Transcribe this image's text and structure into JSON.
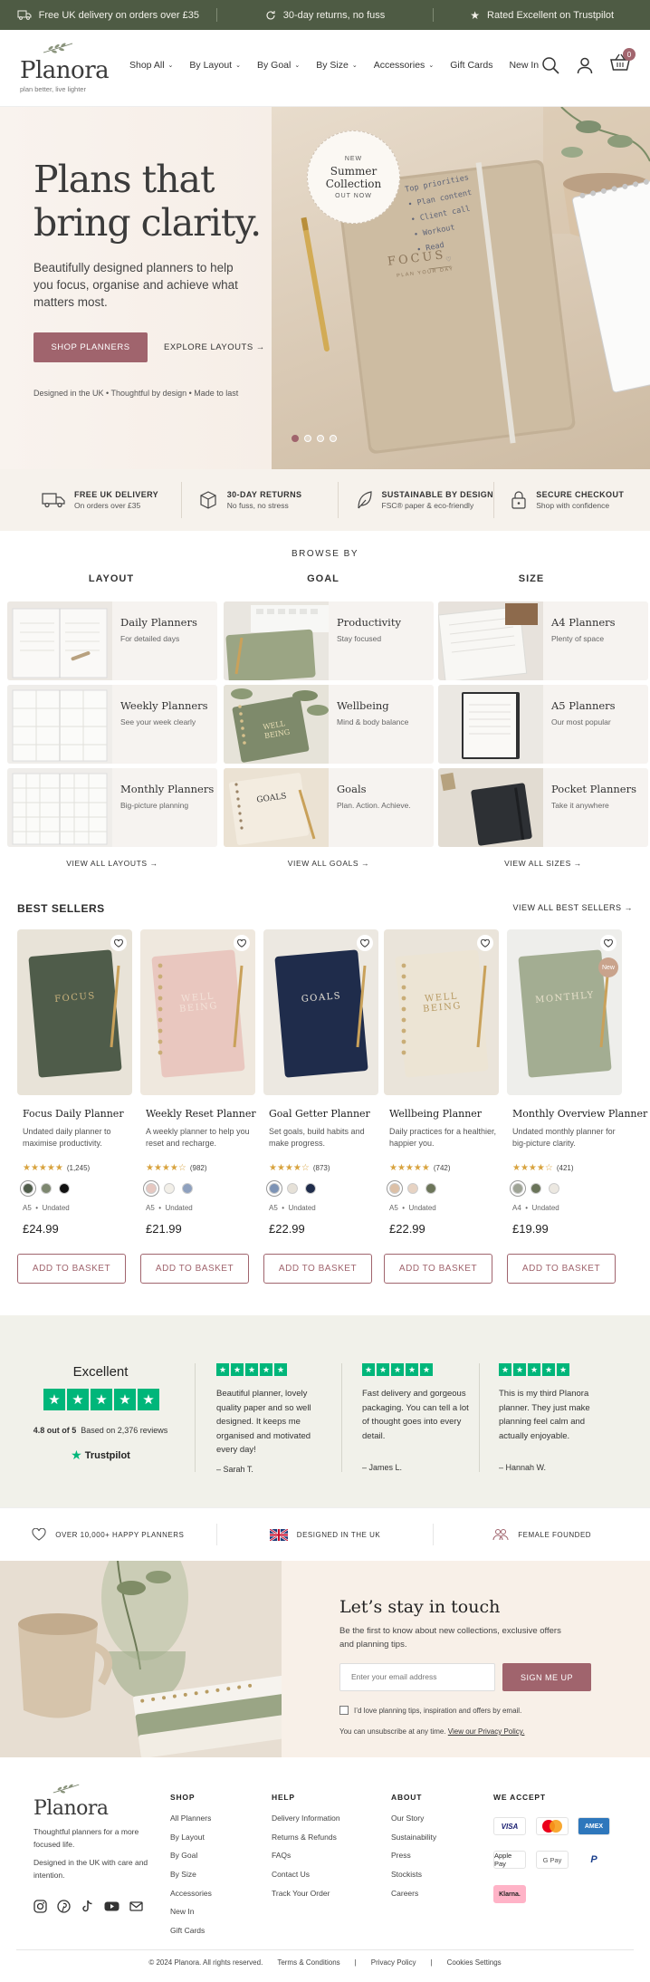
{
  "announcement": {
    "delivery": "Free UK delivery on orders over £35",
    "returns": "30-day returns, no fuss",
    "rating": "Rated Excellent on Trustpilot"
  },
  "brand": {
    "name": "Planora",
    "tagline": "plan better, live lighter"
  },
  "nav": [
    {
      "label": "Shop All",
      "dropdown": true
    },
    {
      "label": "By Layout",
      "dropdown": true
    },
    {
      "label": "By Goal",
      "dropdown": true
    },
    {
      "label": "By Size",
      "dropdown": true
    },
    {
      "label": "Accessories",
      "dropdown": true
    },
    {
      "label": "Gift Cards",
      "dropdown": false
    },
    {
      "label": "New In",
      "dropdown": false
    }
  ],
  "cart_count": "0",
  "hero": {
    "title_line1": "Plans that",
    "title_line2": "bring clarity.",
    "subtitle": "Beautifully designed planners to help you focus, organise and achieve what matters most.",
    "cta_primary": "SHOP PLANNERS",
    "cta_secondary": "EXPLORE LAYOUTS →",
    "meta": "Designed in the UK  •  Thoughtful by design  •  Made to last",
    "badge_top": "NEW",
    "badge_title": "Summer Collection",
    "badge_bottom": "OUT NOW",
    "notebook_cover": "FOCUS",
    "notebook_sub": "PLAN YOUR DAY",
    "notepad_lines": [
      "Top priorities",
      "• Plan content",
      "• Client call",
      "• Workout",
      "• Read",
      "♡"
    ],
    "slides": 4,
    "active_slide": 1
  },
  "usp": [
    {
      "icon": "truck-icon",
      "title": "FREE UK DELIVERY",
      "sub": "On orders over £35"
    },
    {
      "icon": "box-icon",
      "title": "30-DAY RETURNS",
      "sub": "No fuss, no stress"
    },
    {
      "icon": "leaf-icon",
      "title": "SUSTAINABLE BY DESIGN",
      "sub": "FSC® paper & eco-friendly"
    },
    {
      "icon": "lock-icon",
      "title": "SECURE CHECKOUT",
      "sub": "Shop with confidence"
    }
  ],
  "browse": {
    "title": "BROWSE BY",
    "columns": [
      {
        "heading": "LAYOUT",
        "view_all": "VIEW ALL LAYOUTS →",
        "tiles": [
          {
            "title": "Daily Planners",
            "sub": "For detailed days"
          },
          {
            "title": "Weekly Planners",
            "sub": "See your week clearly"
          },
          {
            "title": "Monthly Planners",
            "sub": "Big-picture planning"
          }
        ]
      },
      {
        "heading": "GOAL",
        "view_all": "VIEW ALL GOALS →",
        "tiles": [
          {
            "title": "Productivity",
            "sub": "Stay focused"
          },
          {
            "title": "Wellbeing",
            "sub": "Mind & body balance"
          },
          {
            "title": "Goals",
            "sub": "Plan. Action. Achieve."
          }
        ]
      },
      {
        "heading": "SIZE",
        "view_all": "VIEW ALL SIZES →",
        "tiles": [
          {
            "title": "A4 Planners",
            "sub": "Plenty of space"
          },
          {
            "title": "A5 Planners",
            "sub": "Our most popular"
          },
          {
            "title": "Pocket Planners",
            "sub": "Take it anywhere"
          }
        ]
      }
    ]
  },
  "best_sellers": {
    "title": "BEST SELLERS",
    "view_all": "VIEW ALL BEST SELLERS →",
    "add_label": "ADD TO BASKET",
    "products": [
      {
        "name": "Focus Daily Planner",
        "desc": "Undated daily planner to maximise productivity.",
        "stars": "★★★★★",
        "reviews": "(1,245)",
        "size": "A5",
        "dating": "Undated",
        "price": "£24.99",
        "cover_text": "FOCUS",
        "cover": "#4f5c4a",
        "bg": "#e8e3d8",
        "text_color": "#c9b27c",
        "swatches": [
          "#4f5c4a",
          "#7d876f",
          "#111111"
        ],
        "new": false
      },
      {
        "name": "Weekly Reset Planner",
        "desc": "A weekly planner to help you reset and recharge.",
        "stars": "★★★★☆",
        "reviews": "(982)",
        "size": "A5",
        "dating": "Undated",
        "price": "£21.99",
        "cover_text": "WELL BEING",
        "cover": "#e9c7bf",
        "bg": "#efe8de",
        "text_color": "#f3e2d8",
        "swatches": [
          "#e6c8c1",
          "#f2efe8",
          "#8ea0be"
        ],
        "new": false
      },
      {
        "name": "Goal Getter Planner",
        "desc": "Set goals, build habits and make progress.",
        "stars": "★★★★☆",
        "reviews": "(873)",
        "size": "A5",
        "dating": "Undated",
        "price": "£22.99",
        "cover_text": "GOALS",
        "cover": "#1f2c4b",
        "bg": "#ece8e1",
        "text_color": "#e7e2d6",
        "swatches": [
          "#7d93b5",
          "#e6e1d8",
          "#1f2c4b"
        ],
        "new": false
      },
      {
        "name": "Wellbeing Planner",
        "desc": "Daily practices for a healthier, happier you.",
        "stars": "★★★★★",
        "reviews": "(742)",
        "size": "A5",
        "dating": "Undated",
        "price": "£22.99",
        "cover_text": "WELL BEING",
        "cover": "#ece4d4",
        "bg": "#eae4da",
        "text_color": "#b79a63",
        "swatches": [
          "#dcc0a7",
          "#e7d3c3",
          "#6c7559"
        ],
        "new": false
      },
      {
        "name": "Monthly Overview Planner",
        "desc": "Undated monthly planner for big-picture clarity.",
        "stars": "★★★★☆",
        "reviews": "(421)",
        "size": "A4",
        "dating": "Undated",
        "price": "£19.99",
        "cover_text": "MONTHLY",
        "cover": "#a3ad92",
        "bg": "#eeeeeb",
        "text_color": "#e6dfc9",
        "swatches": [
          "#9ea395",
          "#6a7459",
          "#ece8e1"
        ],
        "new": true,
        "new_label": "New"
      }
    ]
  },
  "trustpilot": {
    "excellent": "Excellent",
    "score": "4.8 out of 5",
    "based_on": "Based on 2,376 reviews",
    "brand": "Trustpilot",
    "reviews": [
      {
        "text": "Beautiful planner, lovely quality paper and so well designed. It keeps me organised and motivated every day!",
        "author": "– Sarah T."
      },
      {
        "text": "Fast delivery and gorgeous packaging. You can tell a lot of thought goes into every detail.",
        "author": "– James L."
      },
      {
        "text": "This is my third Planora planner. They just make planning feel calm and actually enjoyable.",
        "author": "– Hannah W."
      }
    ]
  },
  "trust_bar": [
    {
      "icon": "heart-icon",
      "label": "OVER 10,000+ HAPPY PLANNERS"
    },
    {
      "icon": "uk-flag-icon",
      "label": "DESIGNED IN THE UK"
    },
    {
      "icon": "people-icon",
      "label": "FEMALE FOUNDED"
    }
  ],
  "newsletter": {
    "title": "Let’s stay in touch",
    "text": "Be the first to know about new collections, exclusive offers and planning tips.",
    "placeholder": "Enter your email address",
    "button": "SIGN ME UP",
    "checkbox": "I’d love planning tips, inspiration and offers by email.",
    "unsub": "You can unsubscribe at any time.",
    "privacy_link": "View our Privacy Policy."
  },
  "footer": {
    "about1": "Thoughtful planners for a more focused life.",
    "about2": "Designed in the UK with care and intention.",
    "columns": [
      {
        "title": "SHOP",
        "links": [
          "All Planners",
          "By Layout",
          "By Goal",
          "By Size",
          "Accessories",
          "New In",
          "Gift Cards"
        ]
      },
      {
        "title": "HELP",
        "links": [
          "Delivery Information",
          "Returns & Refunds",
          "FAQs",
          "Contact Us",
          "Track Your Order"
        ]
      },
      {
        "title": "ABOUT",
        "links": [
          "Our Story",
          "Sustainability",
          "Press",
          "Stockists",
          "Careers"
        ]
      }
    ],
    "accept_title": "WE ACCEPT",
    "payments": [
      "VISA",
      "mastercard",
      "AMEX",
      "Apple Pay",
      "G Pay",
      "PayPal",
      "Klarna."
    ],
    "copyright": "© 2024 Planora. All rights reserved.",
    "legal": [
      "Terms & Conditions",
      "Privacy Policy",
      "Cookies Settings"
    ]
  },
  "colors": {
    "primary": "#a0646d",
    "announcement": "#4e5b44",
    "trustpilot": "#00b67a"
  }
}
